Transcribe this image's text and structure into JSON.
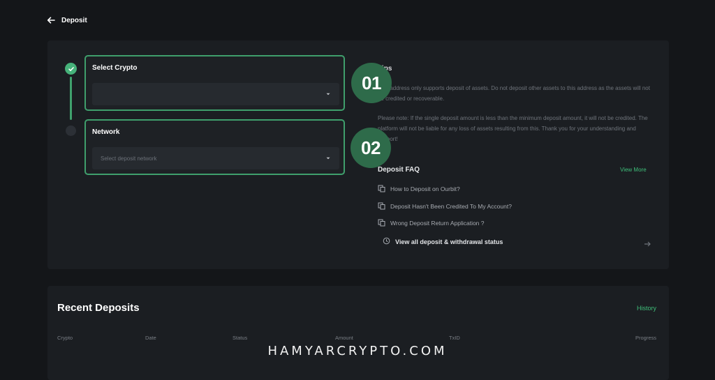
{
  "header": {
    "title": "Deposit"
  },
  "steps": {
    "crypto": {
      "label": "Select Crypto",
      "placeholder": ""
    },
    "network": {
      "label": "Network",
      "placeholder": "Select deposit network"
    }
  },
  "badges": {
    "one": "01",
    "two": "02"
  },
  "tips": {
    "title": "Tips",
    "text1": "This address only supports deposit of assets. Do not deposit other assets to this address as the assets will not be credited or recoverable.",
    "text2": "Please note: If the single deposit amount is less than the minimum deposit amount, it will not be credited. The platform will not be liable for any loss of assets resulting from this. Thank you for your understanding and support!"
  },
  "faq": {
    "title": "Deposit FAQ",
    "view_more": "View More",
    "items": [
      "How to Deposit on Ourbit?",
      "Deposit Hasn't Been Credited To My Account?",
      "Wrong Deposit Return Application ?"
    ],
    "status_link": "View all deposit & withdrawal status"
  },
  "recent": {
    "title": "Recent Deposits",
    "history": "History",
    "columns": [
      "Crypto",
      "Date",
      "Status",
      "Amount",
      "TxID",
      "Progress"
    ]
  },
  "watermark": "HAMYARCRYPTO.COM",
  "colors": {
    "accent": "#3fbf7a",
    "border": "#3f9f6c",
    "badge": "#2e6b4a"
  }
}
